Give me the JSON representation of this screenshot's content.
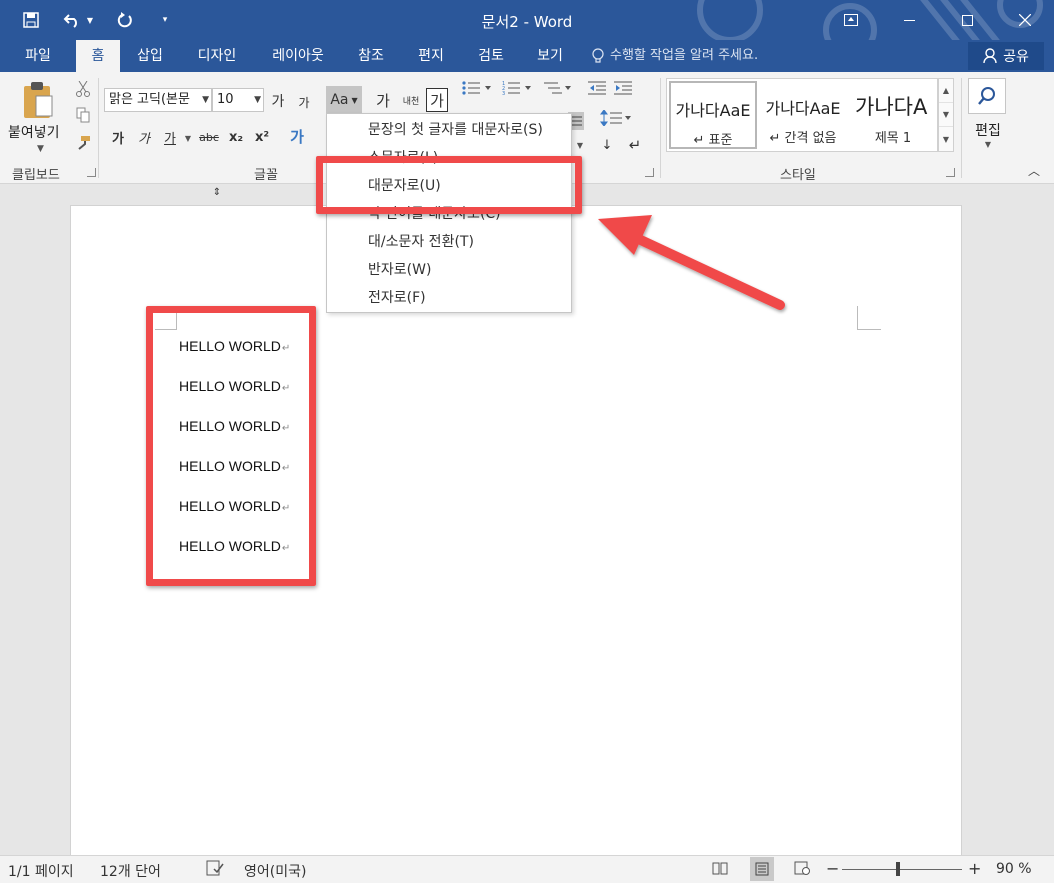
{
  "window": {
    "title": "문서2 - Word"
  },
  "tabs": [
    {
      "label": "파일"
    },
    {
      "label": "홈"
    },
    {
      "label": "삽입"
    },
    {
      "label": "디자인"
    },
    {
      "label": "레이아웃"
    },
    {
      "label": "참조"
    },
    {
      "label": "편지"
    },
    {
      "label": "검토"
    },
    {
      "label": "보기"
    }
  ],
  "tellme": "수행할 작업을 알려 주세요.",
  "share": "공유",
  "ribbon": {
    "clipboard": {
      "paste": "붙여넣기",
      "label": "클립보드"
    },
    "font": {
      "name": "맑은 고딕(본문",
      "size": "10",
      "grow": "가",
      "shrink": "가",
      "case_btn": "Aa",
      "clear": "가",
      "phonetic": "내천",
      "charborder": "가",
      "bold": "가",
      "italic": "가",
      "underline": "가",
      "strike": "abc",
      "sub": "x₂",
      "sup": "x²",
      "effects": "가",
      "label": "글꼴"
    },
    "styles": {
      "label": "스타일",
      "items": [
        {
          "sample": "가나다AaE",
          "name": "↵ 표준"
        },
        {
          "sample": "가나다AaE",
          "name": "↵ 간격 없음"
        },
        {
          "sample": "가나다A",
          "name": "제목 1"
        }
      ]
    },
    "editing": {
      "label": "편집"
    }
  },
  "case_menu": {
    "items": [
      {
        "label": "문장의 첫 글자를 대문자로(S)"
      },
      {
        "label": "소문자로(L)"
      },
      {
        "label": "대문자로(U)"
      },
      {
        "label": "각 단어를 대문자로(C)"
      },
      {
        "label": "대/소문자 전환(T)"
      },
      {
        "label": "반자로(W)"
      },
      {
        "label": "전자로(F)"
      }
    ]
  },
  "document": {
    "lines": [
      "HELLO WORLD",
      "HELLO WORLD",
      "HELLO WORLD",
      "HELLO WORLD",
      "HELLO WORLD",
      "HELLO WORLD"
    ],
    "para_mark": "↵"
  },
  "status": {
    "page": "1/1 페이지",
    "words": "12개 단어",
    "language": "영어(미국)",
    "zoom": "90 %",
    "zoom_minus": "−",
    "zoom_plus": "+"
  },
  "colors": {
    "word_blue": "#2b579a",
    "highlight": "#f04a4a"
  }
}
